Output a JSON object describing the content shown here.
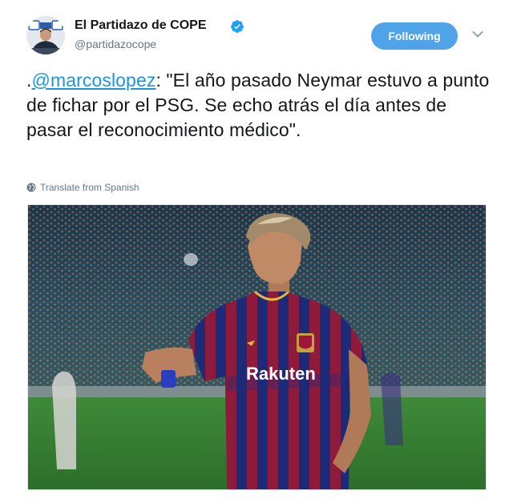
{
  "account": {
    "display_name": "El Partidazo de COPE",
    "handle": "@partidazocope",
    "verified": true
  },
  "follow_button": {
    "label": "Following"
  },
  "tweet": {
    "prefix": ".",
    "mention": "@marcoslopez",
    "text": ": \"El año pasado Neymar estuvo a punto de fichar por el PSG. Se echo atrás el día antes de pasar el reconocimiento médico\"."
  },
  "translate": {
    "label": "Translate from Spanish"
  },
  "photo": {
    "shirt_text": "Rakuten"
  },
  "icons": [
    "verified-badge-icon",
    "chevron-down-icon",
    "globe-icon"
  ],
  "colors": {
    "accent": "#1b95e0",
    "button": "#4fa3e8",
    "muted": "#657786"
  }
}
